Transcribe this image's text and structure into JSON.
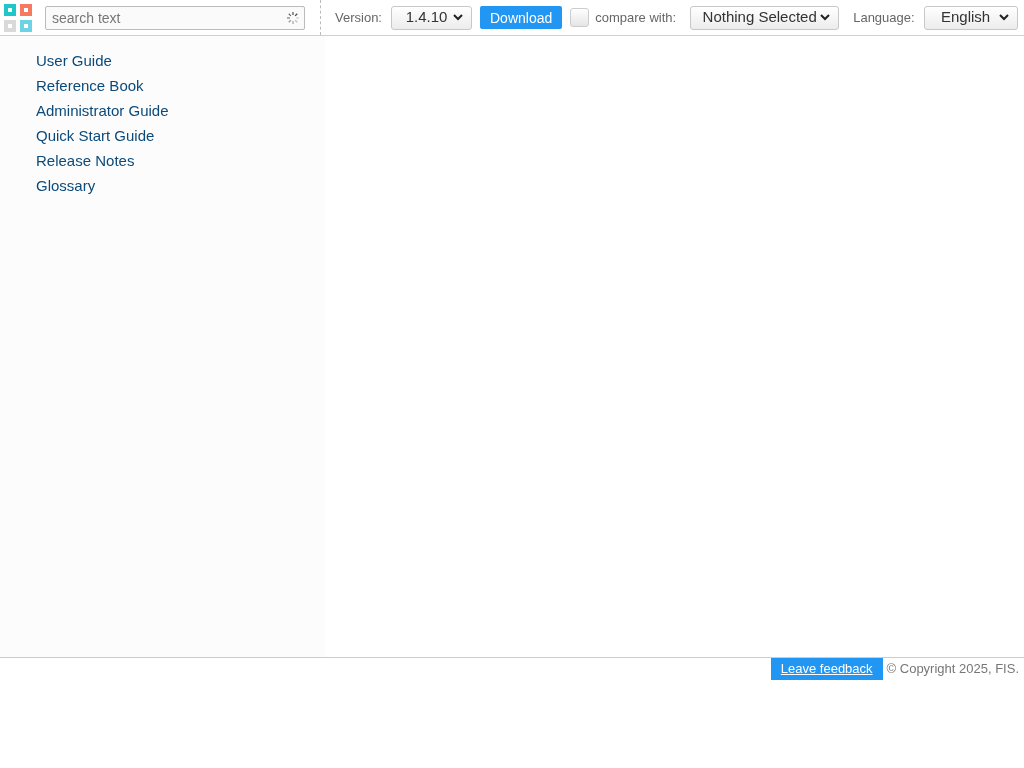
{
  "search": {
    "placeholder": "search text"
  },
  "version": {
    "label": "Version:",
    "value": "1.4.10"
  },
  "download_button": "Download",
  "compare": {
    "checked": false,
    "label": "compare with:",
    "value": "Nothing Selected"
  },
  "language": {
    "label": "Language:",
    "value": "English"
  },
  "sidebar": {
    "items": [
      {
        "label": "User Guide"
      },
      {
        "label": "Reference Book"
      },
      {
        "label": "Administrator Guide"
      },
      {
        "label": "Quick Start Guide"
      },
      {
        "label": "Release Notes"
      },
      {
        "label": "Glossary"
      }
    ]
  },
  "footer": {
    "feedback": "Leave feedback",
    "copyright": "© Copyright 2025, FIS."
  }
}
